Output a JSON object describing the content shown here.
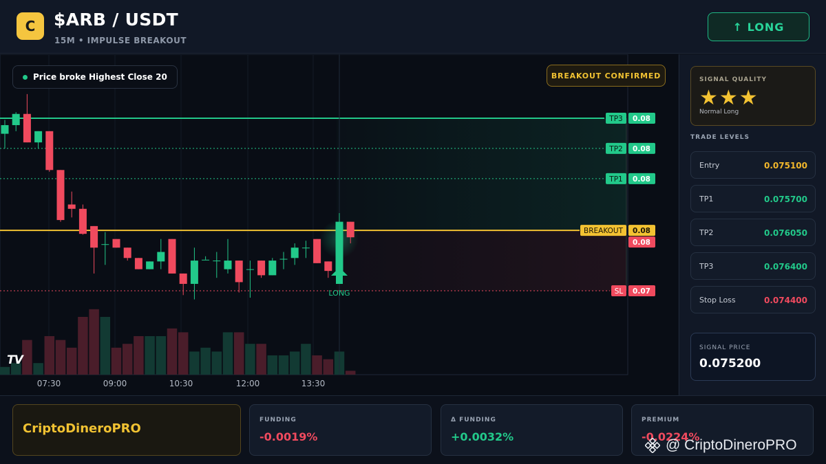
{
  "header": {
    "logo_letter": "C",
    "title": "$ARB / USDT",
    "subtitle": "15M • IMPULSE BREAKOUT",
    "direction_button": "↑ LONG"
  },
  "chart": {
    "info_pill": "Price broke Highest Close 20",
    "confirm_badge": "BREAKOUT CONFIRMED",
    "signal_marker_label": "LONG",
    "tv_logo": "TV",
    "time_labels": [
      "07:30",
      "09:00",
      "10:30",
      "12:00",
      "13:30"
    ],
    "level_tags": [
      {
        "name": "TP3",
        "value": "0.08"
      },
      {
        "name": "TP2",
        "value": "0.08"
      },
      {
        "name": "TP1",
        "value": "0.08"
      },
      {
        "name": "BREAKOUT",
        "value": "0.08"
      },
      {
        "name": "",
        "value": "0.08"
      },
      {
        "name": "SL",
        "value": "0.07"
      }
    ],
    "colors": {
      "up": "#22c98a",
      "down": "#f04a5e",
      "breakout": "#f3c232"
    }
  },
  "chart_data": {
    "type": "candlestick",
    "x_ticks": [
      "07:30",
      "09:00",
      "10:30",
      "12:00",
      "13:30"
    ],
    "levels": {
      "entry": 0.0751,
      "tp1": 0.0757,
      "tp2": 0.07605,
      "tp3": 0.0764,
      "stop_loss": 0.0744,
      "breakout": 0.0751
    },
    "candles": [
      {
        "o": 0.07622,
        "h": 0.07638,
        "l": 0.07605,
        "c": 0.07632
      },
      {
        "o": 0.07632,
        "h": 0.07647,
        "l": 0.07625,
        "c": 0.07645
      },
      {
        "o": 0.07645,
        "h": 0.07668,
        "l": 0.07612,
        "c": 0.07612
      },
      {
        "o": 0.07612,
        "h": 0.07625,
        "l": 0.07605,
        "c": 0.07625
      },
      {
        "o": 0.07625,
        "h": 0.07625,
        "l": 0.07578,
        "c": 0.0758
      },
      {
        "o": 0.0758,
        "h": 0.0758,
        "l": 0.0752,
        "c": 0.07522
      },
      {
        "o": 0.0754,
        "h": 0.07555,
        "l": 0.07525,
        "c": 0.07535
      },
      {
        "o": 0.07535,
        "h": 0.0754,
        "l": 0.07505,
        "c": 0.07506
      },
      {
        "o": 0.07515,
        "h": 0.07515,
        "l": 0.0746,
        "c": 0.0749
      },
      {
        "o": 0.07494,
        "h": 0.07508,
        "l": 0.0747,
        "c": 0.07494
      },
      {
        "o": 0.075,
        "h": 0.075,
        "l": 0.0749,
        "c": 0.0749
      },
      {
        "o": 0.0749,
        "h": 0.0749,
        "l": 0.07475,
        "c": 0.07478
      },
      {
        "o": 0.07478,
        "h": 0.07478,
        "l": 0.07465,
        "c": 0.07465
      },
      {
        "o": 0.07465,
        "h": 0.07474,
        "l": 0.07465,
        "c": 0.07474
      },
      {
        "o": 0.07474,
        "h": 0.075,
        "l": 0.07465,
        "c": 0.07485
      },
      {
        "o": 0.075,
        "h": 0.075,
        "l": 0.0746,
        "c": 0.0746
      },
      {
        "o": 0.0746,
        "h": 0.0746,
        "l": 0.07435,
        "c": 0.07448
      },
      {
        "o": 0.07448,
        "h": 0.0749,
        "l": 0.0743,
        "c": 0.07475
      },
      {
        "o": 0.07476,
        "h": 0.0748,
        "l": 0.07476,
        "c": 0.07476
      },
      {
        "o": 0.07475,
        "h": 0.07485,
        "l": 0.07455,
        "c": 0.07475
      },
      {
        "o": 0.07465,
        "h": 0.075,
        "l": 0.0746,
        "c": 0.07475
      },
      {
        "o": 0.07475,
        "h": 0.07475,
        "l": 0.07438,
        "c": 0.0745
      },
      {
        "o": 0.07465,
        "h": 0.07475,
        "l": 0.07432,
        "c": 0.07465
      },
      {
        "o": 0.07475,
        "h": 0.07475,
        "l": 0.07455,
        "c": 0.07458
      },
      {
        "o": 0.07458,
        "h": 0.07478,
        "l": 0.07458,
        "c": 0.07475
      },
      {
        "o": 0.07477,
        "h": 0.07485,
        "l": 0.07465,
        "c": 0.07477
      },
      {
        "o": 0.07478,
        "h": 0.07495,
        "l": 0.0747,
        "c": 0.0749
      },
      {
        "o": 0.0749,
        "h": 0.07498,
        "l": 0.07478,
        "c": 0.0749
      },
      {
        "o": 0.075,
        "h": 0.075,
        "l": 0.07472,
        "c": 0.07472
      },
      {
        "o": 0.07474,
        "h": 0.07474,
        "l": 0.07455,
        "c": 0.07463
      },
      {
        "o": 0.07463,
        "h": 0.0753,
        "l": 0.07463,
        "c": 0.0752
      },
      {
        "o": 0.0752,
        "h": 0.0752,
        "l": 0.07495,
        "c": 0.07502
      }
    ],
    "volume": [
      2,
      3,
      9,
      3,
      10,
      9,
      7,
      15,
      17,
      15,
      7,
      8,
      10,
      10,
      10,
      12,
      11,
      6,
      7,
      6,
      11,
      11,
      8,
      8,
      5,
      5,
      6,
      8,
      5,
      4,
      6,
      1
    ]
  },
  "sidebar": {
    "quality_label": "SIGNAL QUALITY",
    "stars": "★★★",
    "quality_sub": "Normal Long",
    "levels_label": "TRADE LEVELS",
    "levels": [
      {
        "name": "Entry",
        "value": "0.075100",
        "color": "#f3b82b"
      },
      {
        "name": "TP1",
        "value": "0.075700",
        "color": "#22c98a"
      },
      {
        "name": "TP2",
        "value": "0.076050",
        "color": "#22c98a"
      },
      {
        "name": "TP3",
        "value": "0.076400",
        "color": "#22c98a"
      },
      {
        "name": "Stop Loss",
        "value": "0.074400",
        "color": "#f04a5e"
      }
    ],
    "signal_price_label": "SIGNAL PRICE",
    "signal_price": "0.075200"
  },
  "footer": {
    "brand": "CriptoDineroPRO",
    "stats": [
      {
        "label": "FUNDING",
        "value": "-0.0019%",
        "color": "#f04a5e"
      },
      {
        "label": "Δ FUNDING",
        "value": "+0.0032%",
        "color": "#22c98a"
      },
      {
        "label": "PREMIUM",
        "value": "-0.0224%",
        "color": "#f04a5e"
      }
    ],
    "watermark": "@ CriptoDineroPRO"
  }
}
